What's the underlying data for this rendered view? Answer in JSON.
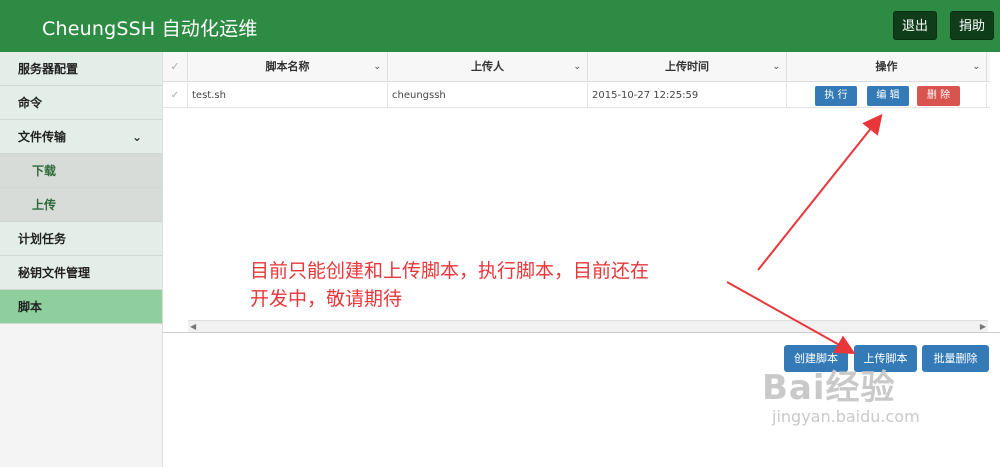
{
  "header": {
    "title": "CheungSSH 自动化运维",
    "logout": "退出",
    "donate": "捐助"
  },
  "sidebar": {
    "items": [
      {
        "label": "服务器配置"
      },
      {
        "label": "命令"
      },
      {
        "label": "文件传输"
      },
      {
        "label": "下载"
      },
      {
        "label": "上传"
      },
      {
        "label": "计划任务"
      },
      {
        "label": "秘钥文件管理"
      },
      {
        "label": "脚本"
      }
    ]
  },
  "table": {
    "headers": [
      "脚本名称",
      "上传人",
      "上传时间",
      "操作"
    ],
    "rows": [
      {
        "name": "test.sh",
        "uploader": "cheungssh",
        "time": "2015-10-27 12:25:59",
        "actions": {
          "execute": "执 行",
          "edit": "编 辑",
          "delete": "删 除"
        }
      }
    ]
  },
  "footer_buttons": {
    "create": "创建脚本",
    "upload": "上传脚本",
    "batch_delete": "批量删除"
  },
  "annotation": {
    "line1": "目前只能创建和上传脚本，执行脚本，目前还在",
    "line2": "开发中，敬请期待"
  },
  "watermark": {
    "brand": "Bai经验",
    "url": "jingyan.baidu.com"
  },
  "colors": {
    "header_bg": "#2e8b43",
    "primary": "#337ab7",
    "danger": "#d9534f",
    "annotation": "#e8363b"
  }
}
